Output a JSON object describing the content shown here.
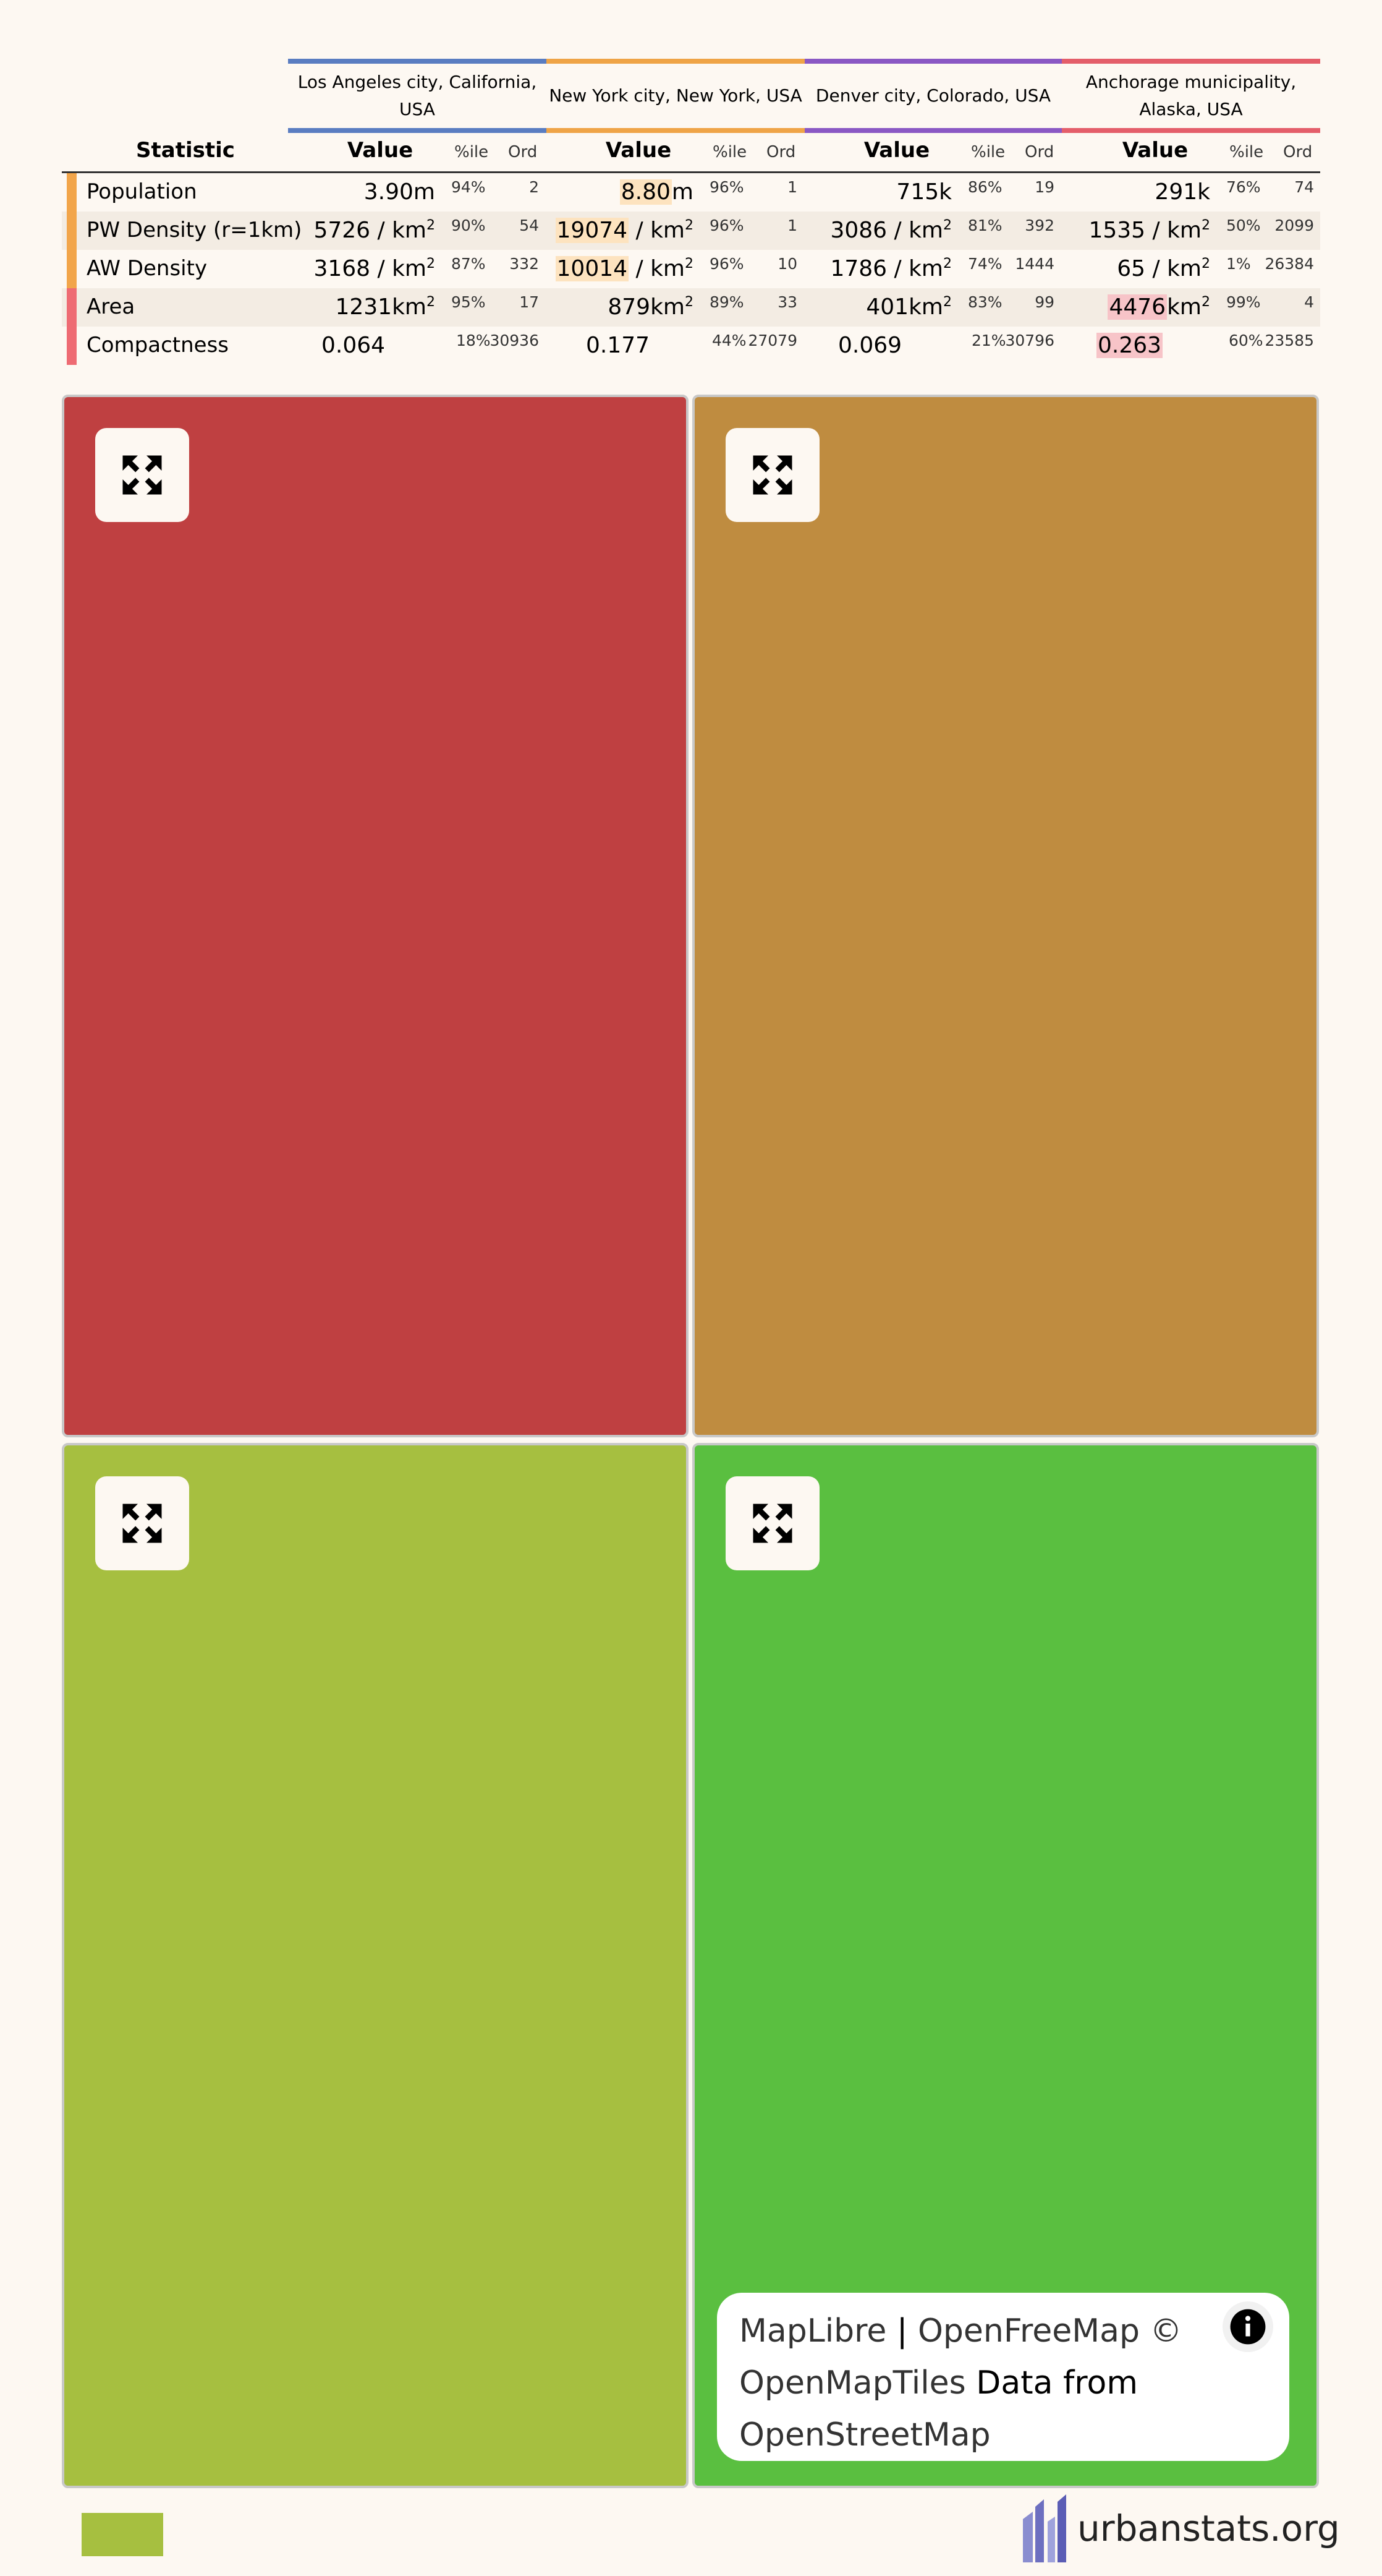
{
  "colors": {
    "background": "#fdf8f2",
    "region_colors": [
      "#5a7dc1",
      "#efa447",
      "#8a58c4",
      "#e45e6a"
    ],
    "row_colors": [
      "#f2a54a",
      "#f2a54a",
      "#f2a54a",
      "#ee6b73",
      "#ee6b73"
    ],
    "highlight_orange": "#fde3bf",
    "highlight_pink": "#f7c4c8",
    "map_colors": [
      "#bf4041",
      "#bf8c40",
      "#a6bf40",
      "#5abf40"
    ],
    "legend_color": "#a6bf40"
  },
  "regions": [
    {
      "name": "Los Angeles city, California, USA"
    },
    {
      "name": "New York city, New York, USA"
    },
    {
      "name": "Denver city, Colorado, USA"
    },
    {
      "name": "Anchorage municipality, Alaska, USA"
    }
  ],
  "headers": {
    "statistic": "Statistic",
    "value": "Value",
    "pctile": "%ile",
    "ord": "Ord"
  },
  "rows": [
    {
      "name": "Population",
      "cells": [
        {
          "value": "3.90",
          "unit": "m",
          "sup": "",
          "pctile": "94%",
          "ord": "2"
        },
        {
          "value": "8.80",
          "unit": "m",
          "sup": "",
          "pctile": "96%",
          "ord": "1"
        },
        {
          "value": "715",
          "unit": "k",
          "sup": "",
          "pctile": "86%",
          "ord": "19"
        },
        {
          "value": "291",
          "unit": "k",
          "sup": "",
          "pctile": "76%",
          "ord": "74"
        }
      ]
    },
    {
      "name": "PW Density (r=1km)",
      "cells": [
        {
          "value": "5726",
          "unit": " / km",
          "sup": "2",
          "pctile": "90%",
          "ord": "54"
        },
        {
          "value": "19074",
          "unit": " / km",
          "sup": "2",
          "pctile": "96%",
          "ord": "1"
        },
        {
          "value": "3086",
          "unit": " / km",
          "sup": "2",
          "pctile": "81%",
          "ord": "392"
        },
        {
          "value": "1535",
          "unit": " / km",
          "sup": "2",
          "pctile": "50%",
          "ord": "2099"
        }
      ]
    },
    {
      "name": "AW Density",
      "cells": [
        {
          "value": "3168",
          "unit": " / km",
          "sup": "2",
          "pctile": "87%",
          "ord": "332"
        },
        {
          "value": "10014",
          "unit": " / km",
          "sup": "2",
          "pctile": "96%",
          "ord": "10"
        },
        {
          "value": "1786",
          "unit": " / km",
          "sup": "2",
          "pctile": "74%",
          "ord": "1444"
        },
        {
          "value": "65",
          "unit": " / km",
          "sup": "2",
          "pctile": "1%",
          "ord": "26384"
        }
      ]
    },
    {
      "name": "Area",
      "cells": [
        {
          "value": "1231",
          "unit": "km",
          "sup": "2",
          "pctile": "95%",
          "ord": "17"
        },
        {
          "value": "879",
          "unit": "km",
          "sup": "2",
          "pctile": "89%",
          "ord": "33"
        },
        {
          "value": "401",
          "unit": "km",
          "sup": "2",
          "pctile": "83%",
          "ord": "99"
        },
        {
          "value": "4476",
          "unit": "km",
          "sup": "2",
          "pctile": "99%",
          "ord": "4"
        }
      ]
    },
    {
      "name": "Compactness",
      "cells": [
        {
          "value": "0.064",
          "unit": "",
          "sup": "",
          "pctile": "18%",
          "ord": "30936"
        },
        {
          "value": "0.177",
          "unit": "",
          "sup": "",
          "pctile": "44%",
          "ord": "27079"
        },
        {
          "value": "0.069",
          "unit": "",
          "sup": "",
          "pctile": "21%",
          "ord": "30796"
        },
        {
          "value": "0.263",
          "unit": "",
          "sup": "",
          "pctile": "60%",
          "ord": "23585"
        }
      ]
    }
  ],
  "maps": [
    {
      "icon": "expand-icon"
    },
    {
      "icon": "expand-icon"
    },
    {
      "icon": "expand-icon"
    },
    {
      "icon": "expand-icon"
    }
  ],
  "attribution": {
    "maplibre": "MapLibre",
    "sep": " | ",
    "openfreemap": "OpenFreeMap",
    "copy": " © ",
    "openmaptiles": "OpenMapTiles",
    "data_from": " Data from ",
    "osm": "OpenStreetMap",
    "info_icon": "info-icon"
  },
  "footer": {
    "site": "urbanstats.org",
    "logo_icon": "urbanstats-logo-icon"
  }
}
